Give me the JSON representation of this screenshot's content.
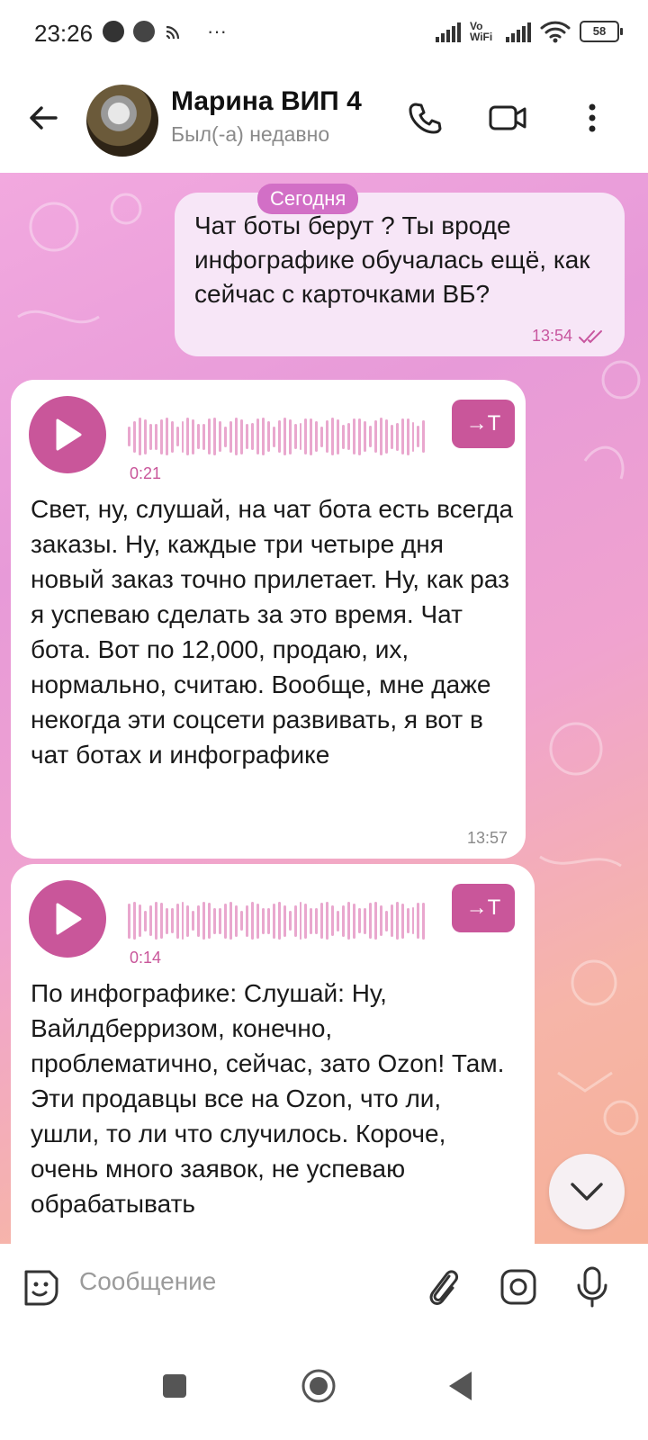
{
  "status_bar": {
    "time": "23:26",
    "battery": "58",
    "network_label": "Vo WiFi"
  },
  "header": {
    "name": "Марина ВИП 4",
    "status": "Был(-а) недавно"
  },
  "chat": {
    "date_chip": "Сегодня",
    "messages": [
      {
        "type": "outgoing",
        "text": "Чат боты берут ? Ты вроде инфографике обучалась ещё, как сейчас с карточками ВБ?",
        "time": "13:54"
      },
      {
        "type": "incoming_voice",
        "duration": "0:21",
        "transcribe_label": "→T",
        "text": "Свет, ну, слушай, на чат бота есть всегда заказы. Ну, каждые три четыре дня новый заказ точно прилетает. Ну, как раз я успеваю сделать за это время. Чат бота. Вот по 12,000, продаю, их, нормально, считаю. Вообще, мне даже некогда эти соцсети развивать, я вот в чат ботах и инфографике",
        "time": "13:57"
      },
      {
        "type": "incoming_voice",
        "duration": "0:14",
        "transcribe_label": "→T",
        "text": "По инфографике: Слушай: Ну, Вайлдберризом, конечно, проблематично, сейчас, зато Ozon! Там. Эти продавцы все на Ozon, что ли, ушли, то ли что случилось. Короче, очень много заявок, не успеваю обрабатывать"
      }
    ]
  },
  "input": {
    "placeholder": "Сообщение"
  },
  "colors": {
    "accent": "#c9569a",
    "outgoing_bubble": "#f7e6f7",
    "wave": "#e9a7ce"
  },
  "icons": {
    "header": [
      "back-arrow-icon",
      "phone-icon",
      "video-icon",
      "more-vert-icon"
    ],
    "input": [
      "sticker-icon",
      "attach-icon",
      "camera-icon",
      "mic-icon"
    ],
    "nav": [
      "recents-icon",
      "home-icon",
      "back-icon"
    ]
  }
}
